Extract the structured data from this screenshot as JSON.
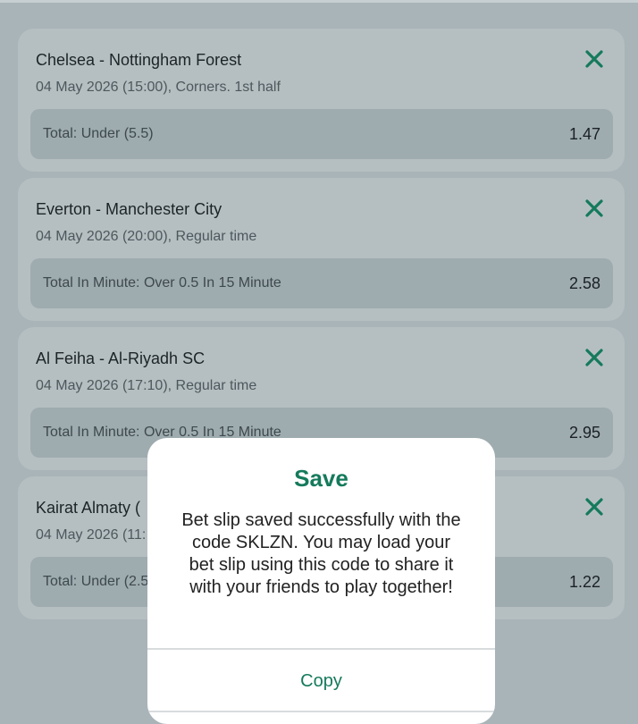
{
  "colors": {
    "accent": "#157a5b",
    "overlay_background": "#a9b4b8",
    "card_background": "#b5bfc2",
    "market_row_background": "#9eabaf"
  },
  "bet_slip": {
    "items": [
      {
        "match": "Chelsea - Nottingham Forest",
        "details": "04 May 2026 (15:00), Corners. 1st half",
        "market": "Total: Under (5.5)",
        "odds": "1.47",
        "remove_icon": "close-icon"
      },
      {
        "match": "Everton - Manchester City",
        "details": "04 May 2026 (20:00), Regular time",
        "market": "Total In Minute: Over 0.5 In 15 Minute",
        "odds": "2.58",
        "remove_icon": "close-icon"
      },
      {
        "match": "Al Feiha - Al-Riyadh SC",
        "details": "04 May 2026 (17:10), Regular time",
        "market": "Total In Minute: Over 0.5 In 15 Minute",
        "odds": "2.95",
        "remove_icon": "close-icon"
      },
      {
        "match": "Kairat Almaty (",
        "details": "04 May 2026 (11:",
        "market": "Total: Under (2.5",
        "odds": "1.22",
        "remove_icon": "close-icon"
      }
    ]
  },
  "dialog": {
    "title": "Save",
    "message": "Bet slip saved successfully with the code SKLZN. You may load your bet slip using this code to share it with your friends to play together!",
    "copy_label": "Copy"
  }
}
